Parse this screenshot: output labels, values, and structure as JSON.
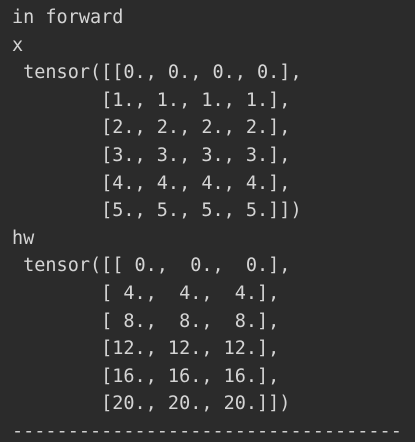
{
  "console": {
    "lines": [
      "in forward",
      "x",
      " tensor([[0., 0., 0., 0.],",
      "        [1., 1., 1., 1.],",
      "        [2., 2., 2., 2.],",
      "        [3., 3., 3., 3.],",
      "        [4., 4., 4., 4.],",
      "        [5., 5., 5., 5.]])",
      "hw",
      " tensor([[ 0.,  0.,  0.],",
      "        [ 4.,  4.,  4.],",
      "        [ 8.,  8.,  8.],",
      "        [12., 12., 12.],",
      "        [16., 16., 16.],",
      "        [20., 20., 20.]])"
    ],
    "separator": "-----------------------------------"
  },
  "colors": {
    "background": "#2b2b2b",
    "text": "#d4d4d4"
  }
}
